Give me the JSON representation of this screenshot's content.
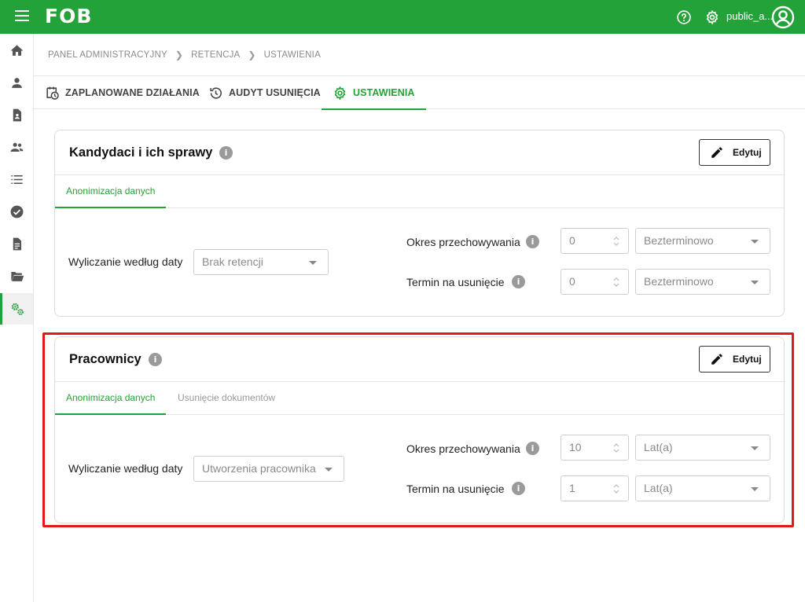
{
  "header": {
    "logo_text": "FOB",
    "username": "public_a...",
    "icons": [
      "menu-icon",
      "help-icon",
      "gear-icon",
      "account-circle-icon"
    ],
    "brand_color": "#24a23a"
  },
  "sidebar": {
    "items": [
      {
        "icon": "home-icon"
      },
      {
        "icon": "person-icon"
      },
      {
        "icon": "document-person-icon"
      },
      {
        "icon": "people-icon"
      },
      {
        "icon": "list-icon"
      },
      {
        "icon": "check-circle-icon"
      },
      {
        "icon": "file-icon"
      },
      {
        "icon": "folder-open-icon"
      },
      {
        "icon": "settings-cogs-icon",
        "active": true
      }
    ]
  },
  "breadcrumb": [
    "PANEL ADMINISTRACYJNY",
    "RETENCJA",
    "USTAWIENIA"
  ],
  "tabs": [
    {
      "label": "ZAPLANOWANE DZIAŁANIA",
      "icon": "calendar-clock-icon"
    },
    {
      "label": "AUDYT USUNIĘCIA",
      "icon": "history-icon"
    },
    {
      "label": "USTAWIENIA",
      "icon": "gear-icon",
      "active": true
    }
  ],
  "cards": [
    {
      "title": "Kandydaci i ich sprawy",
      "info": "i",
      "edit_label": "Edytuj",
      "subtabs": [
        "Anonimizacja danych"
      ],
      "calc_label": "Wyliczanie według daty",
      "calc_value": "Brak retencji",
      "retention_label": "Okres przechowywania",
      "retention_number": "0",
      "retention_unit": "Bezterminowo",
      "deadline_label": "Termin na usunięcie",
      "deadline_number": "0",
      "deadline_unit": "Bezterminowo"
    },
    {
      "title": "Pracownicy",
      "info": "i",
      "edit_label": "Edytuj",
      "subtabs": [
        "Anonimizacja danych",
        "Usunięcie dokumentów"
      ],
      "calc_label": "Wyliczanie według daty",
      "calc_value": "Utworzenia pracownika",
      "retention_label": "Okres przechowywania",
      "retention_number": "10",
      "retention_unit": "Lat(a)",
      "deadline_label": "Termin na usunięcie",
      "deadline_number": "1",
      "deadline_unit": "Lat(a)"
    }
  ]
}
